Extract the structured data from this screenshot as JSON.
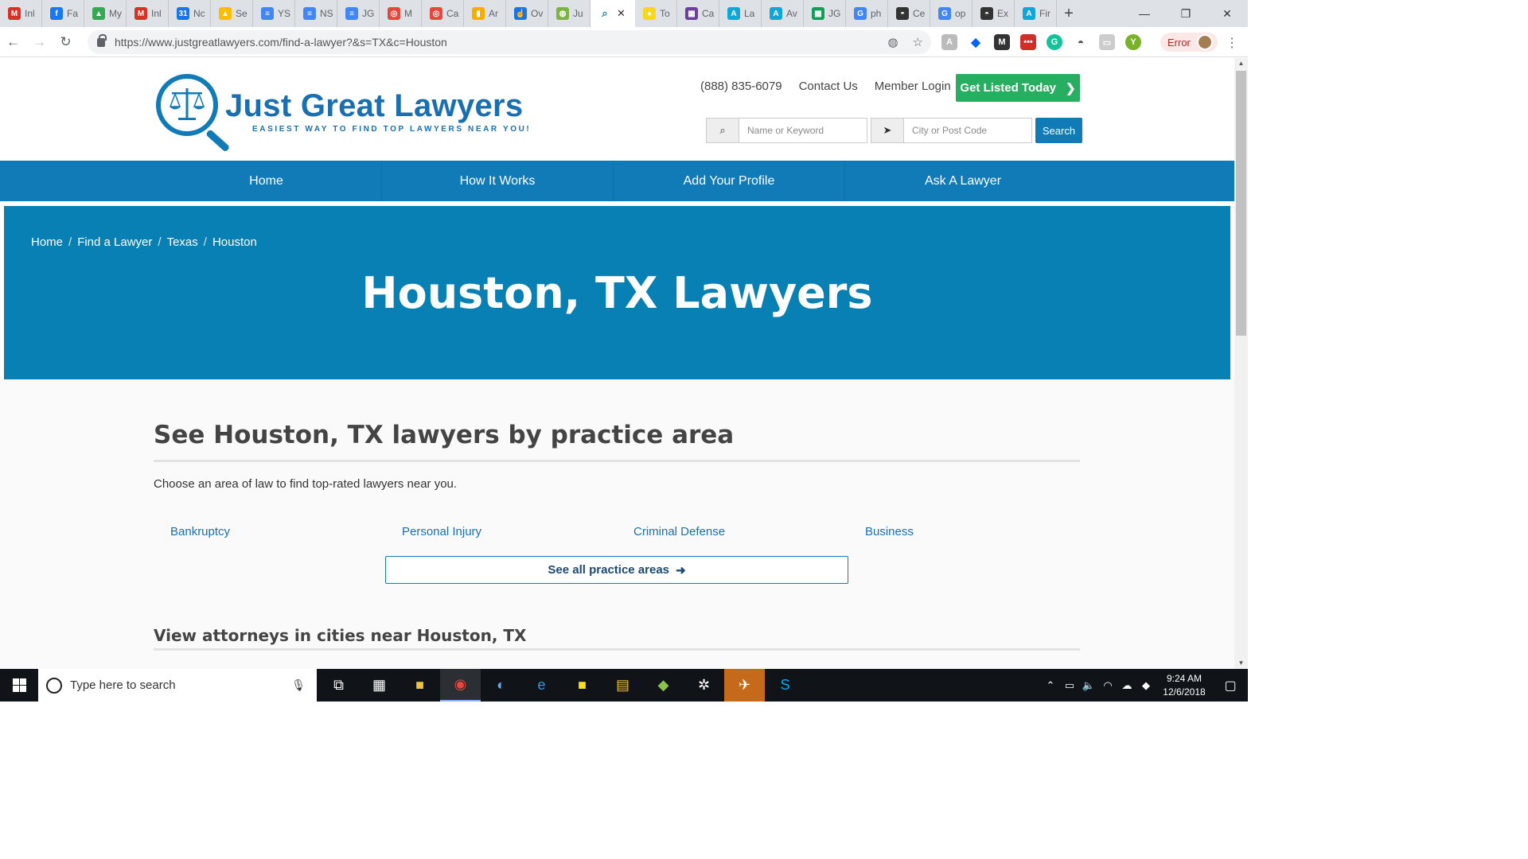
{
  "browser": {
    "tabs": [
      {
        "label": "Inl",
        "icon": "gmail-icon",
        "color": "#d93025",
        "glyph": "M"
      },
      {
        "label": "Fa",
        "icon": "facebook-icon",
        "color": "#1877f2",
        "glyph": "f"
      },
      {
        "label": "My",
        "icon": "drive-icon",
        "color": "#34a853",
        "glyph": "▲"
      },
      {
        "label": "Inl",
        "icon": "gmail-icon",
        "color": "#d93025",
        "glyph": "M"
      },
      {
        "label": "Nc",
        "icon": "calendar-icon",
        "color": "#1a73e8",
        "glyph": "31"
      },
      {
        "label": "Se",
        "icon": "drive-icon",
        "color": "#fbbc04",
        "glyph": "▲"
      },
      {
        "label": "YS",
        "icon": "docs-icon",
        "color": "#4285f4",
        "glyph": "≡"
      },
      {
        "label": "NS",
        "icon": "docs-icon",
        "color": "#4285f4",
        "glyph": "≡"
      },
      {
        "label": "JG",
        "icon": "docs-icon",
        "color": "#4285f4",
        "glyph": "≡"
      },
      {
        "label": "M",
        "icon": "target-icon",
        "color": "#e8453c",
        "glyph": "◎"
      },
      {
        "label": "Ca",
        "icon": "target-icon",
        "color": "#e8453c",
        "glyph": "◎"
      },
      {
        "label": "Ar",
        "icon": "analytics-icon",
        "color": "#f9ab00",
        "glyph": "▮"
      },
      {
        "label": "Ov",
        "icon": "hand-icon",
        "color": "#1a73e8",
        "glyph": "☝"
      },
      {
        "label": "Ju",
        "icon": "globe-icon",
        "color": "#7cb342",
        "glyph": "◍"
      },
      {
        "label": "To",
        "icon": "bulb-icon",
        "color": "#f9d71c",
        "glyph": "●"
      },
      {
        "label": "Ca",
        "icon": "trello-icon",
        "color": "#6b3fa0",
        "glyph": "▦"
      },
      {
        "label": "La",
        "icon": "a-icon",
        "color": "#12a5d8",
        "glyph": "A"
      },
      {
        "label": "Av",
        "icon": "a-icon",
        "color": "#12a5d8",
        "glyph": "A"
      },
      {
        "label": "JG",
        "icon": "sheets-icon",
        "color": "#0f9d58",
        "glyph": "▦"
      },
      {
        "label": "ph",
        "icon": "google-icon",
        "color": "#4285f4",
        "glyph": "G"
      },
      {
        "label": "Ce",
        "icon": "spy-icon",
        "color": "#333333",
        "glyph": "◓"
      },
      {
        "label": "op",
        "icon": "google-icon",
        "color": "#4285f4",
        "glyph": "G"
      },
      {
        "label": "Ex",
        "icon": "spy-icon",
        "color": "#333333",
        "glyph": "◓"
      },
      {
        "label": "Fir",
        "icon": "a-icon",
        "color": "#12a5d8",
        "glyph": "A"
      }
    ],
    "url": "https://www.justgreatlawyers.com/find-a-lawyer?&s=TX&c=Houston",
    "error_label": "Error"
  },
  "site": {
    "logo_title": "Just Great Lawyers",
    "logo_tagline": "EASIEST WAY TO FIND TOP LAWYERS NEAR YOU!",
    "phone": "(888) 835-6079",
    "contact": "Contact Us",
    "login": "Member Login",
    "cta": "Get Listed Today",
    "search": {
      "keyword_placeholder": "Name or Keyword",
      "location_placeholder": "City or Post Code",
      "button": "Search"
    },
    "nav": [
      "Home",
      "How It Works",
      "Add Your Profile",
      "Ask A Lawyer"
    ],
    "breadcrumbs": [
      "Home",
      "Find a Lawyer",
      "Texas",
      "Houston"
    ],
    "hero_title": "Houston, TX Lawyers",
    "section_title": "See Houston, TX lawyers by practice area",
    "intro": "Choose an area of law to find top-rated lawyers near you.",
    "practice_areas": [
      "Bankruptcy",
      "Personal Injury",
      "Criminal Defense",
      "Business"
    ],
    "all_practice_button": "See all practice areas",
    "cities_title": "View attorneys in cities near Houston, TX"
  },
  "taskbar": {
    "search_placeholder": "Type here to search",
    "time": "9:24 AM",
    "date": "12/6/2018"
  },
  "colors": {
    "brand_blue": "#117bb8",
    "hero_blue": "#0880b4",
    "cta_green": "#27ae60"
  }
}
